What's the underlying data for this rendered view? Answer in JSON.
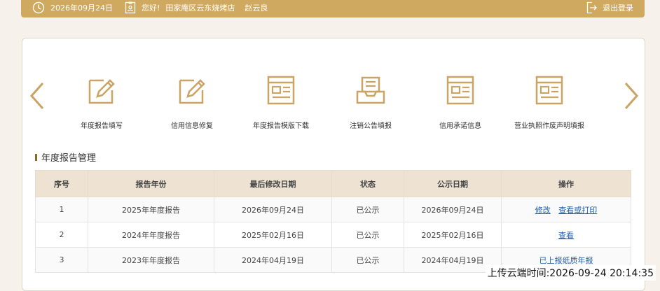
{
  "header": {
    "date": "2026年09月24日",
    "greeting": "您好!",
    "shop_name": "田家庵区云东烧烤店",
    "user_name": "赵云良",
    "logout_label": "退出登录"
  },
  "functions": [
    {
      "label": "年度报告填写",
      "icon": "edit-doc-icon"
    },
    {
      "label": "信用信息修复",
      "icon": "edit-doc-icon"
    },
    {
      "label": "年度报告模版下载",
      "icon": "document-list-icon"
    },
    {
      "label": "注销公告填报",
      "icon": "inbox-tray-icon"
    },
    {
      "label": "信用承诺信息",
      "icon": "document-list-icon"
    },
    {
      "label": "营业执照作废声明填报",
      "icon": "document-list-icon"
    }
  ],
  "section": {
    "title": "年度报告管理"
  },
  "table": {
    "headers": [
      "序号",
      "报告年份",
      "最后修改日期",
      "状态",
      "公示日期",
      "操作"
    ],
    "rows": [
      {
        "no": "1",
        "year": "2025年年度报告",
        "modified": "2026年09月24日",
        "status": "已公示",
        "published": "2026年09月24日",
        "actions": [
          "修改",
          "查看或打印"
        ]
      },
      {
        "no": "2",
        "year": "2024年年度报告",
        "modified": "2025年02月16日",
        "status": "已公示",
        "published": "2025年02月16日",
        "actions": [
          "查看"
        ]
      },
      {
        "no": "3",
        "year": "2023年年度报告",
        "modified": "2024年04月19日",
        "status": "已公示",
        "published": "2024年04月19日",
        "actions": [
          "已上报纸质年报"
        ]
      }
    ]
  },
  "upload_time": "上传云端时间:2026-09-24 20:14:35",
  "colors": {
    "accent": "#cfa95f",
    "icon": "#c9a464",
    "link": "#1d5fb3"
  }
}
